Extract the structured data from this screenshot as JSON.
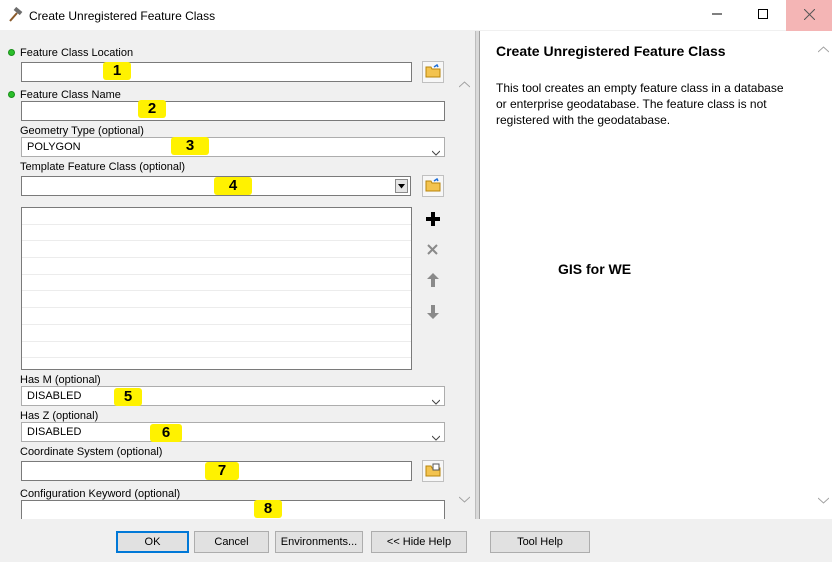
{
  "window": {
    "title": "Create Unregistered Feature Class",
    "controls": {
      "minimize": "minimize-icon",
      "maximize": "maximize-icon",
      "close": "close-icon"
    }
  },
  "form": {
    "location": {
      "label": "Feature Class Location",
      "value": "",
      "marker": "1",
      "required": true
    },
    "name": {
      "label": "Feature Class Name",
      "value": "",
      "marker": "2",
      "required": true
    },
    "geometry": {
      "label": "Geometry Type (optional)",
      "value": "POLYGON",
      "marker": "3"
    },
    "template": {
      "label": "Template Feature Class (optional)",
      "value": "",
      "marker": "4",
      "list_items": []
    },
    "has_m": {
      "label": "Has M (optional)",
      "value": "DISABLED",
      "marker": "5"
    },
    "has_z": {
      "label": "Has Z (optional)",
      "value": "DISABLED",
      "marker": "6"
    },
    "coord": {
      "label": "Coordinate System (optional)",
      "value": "",
      "marker": "7"
    },
    "config": {
      "label": "Configuration Keyword (optional)",
      "value": "",
      "marker": "8"
    }
  },
  "help": {
    "title": "Create Unregistered Feature Class",
    "description": "This tool creates an empty feature class in a database or enterprise geodatabase. The feature class is not registered with the geodatabase.",
    "watermark": "GIS for WE"
  },
  "buttons": {
    "ok": "OK",
    "cancel": "Cancel",
    "environments": "Environments...",
    "hide_help": "<< Hide Help",
    "tool_help": "Tool Help"
  },
  "colors": {
    "marker": "#fff200",
    "required_dot": "#2bbf2b",
    "close_hover": "#f4b5b5",
    "default_button_border": "#0078d7"
  }
}
